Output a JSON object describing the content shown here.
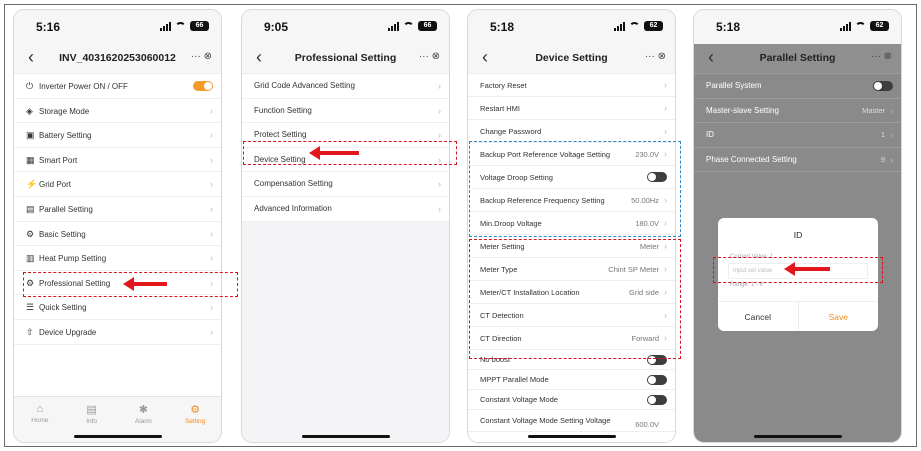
{
  "screens": [
    {
      "time": "5:16",
      "battery": "66",
      "title": "INV_4031620253060012",
      "actions": "··· ⊗",
      "items": [
        {
          "icon": "⏻",
          "label": "Inverter Power ON / OFF",
          "toggle": "on"
        },
        {
          "icon": "◈",
          "label": "Storage Mode"
        },
        {
          "icon": "▣",
          "label": "Battery Setting"
        },
        {
          "icon": "▦",
          "label": "Smart Port"
        },
        {
          "icon": "⚡",
          "label": "Grid Port"
        },
        {
          "icon": "▤",
          "label": "Parallel Setting"
        },
        {
          "icon": "⚙",
          "label": "Basic Setting"
        },
        {
          "icon": "▥",
          "label": "Heat Pump Setting"
        },
        {
          "icon": "⚙",
          "label": "Professional Setting"
        },
        {
          "icon": "☰",
          "label": "Quick Setting"
        },
        {
          "icon": "⇧",
          "label": "Device Upgrade"
        }
      ],
      "tabs": [
        {
          "icon": "⌂",
          "label": "Home"
        },
        {
          "icon": "▤",
          "label": "Info"
        },
        {
          "icon": "✱",
          "label": "Alarm"
        },
        {
          "icon": "⚙",
          "label": "Setting"
        }
      ]
    },
    {
      "time": "9:05",
      "battery": "66",
      "title": "Professional Setting",
      "actions": "··· ⊗",
      "items": [
        {
          "label": "Grid Code Advanced Setting"
        },
        {
          "label": "Function Setting"
        },
        {
          "label": "Protect Setting"
        },
        {
          "label": "Device Setting"
        },
        {
          "label": "Compensation Setting"
        },
        {
          "label": "Advanced Information"
        }
      ]
    },
    {
      "time": "5:18",
      "battery": "62",
      "title": "Device Setting",
      "actions": "··· ⊗",
      "items": [
        {
          "label": "Factory Reset"
        },
        {
          "label": "Restart HMI"
        },
        {
          "label": "Change Password"
        },
        {
          "label": "Backup Port Reference Voltage Setting",
          "value": "230.0V"
        },
        {
          "label": "Voltage Droop Setting",
          "toggle": "off"
        },
        {
          "label": "Backup Reference Frequency Setting",
          "value": "50.00Hz"
        },
        {
          "label": "Min.Droop Voltage",
          "value": "180.0V"
        },
        {
          "label": "Meter Setting",
          "value": "Meter"
        },
        {
          "label": "Meter Type",
          "value": "Chint SP Meter"
        },
        {
          "label": "Meter/CT Installation Location",
          "value": "Grid side"
        },
        {
          "label": "CT Detection"
        },
        {
          "label": "CT Direction",
          "value": "Forward"
        },
        {
          "label": "No boost",
          "toggle": "off"
        },
        {
          "label": "MPPT Parallel Mode",
          "toggle": "off"
        },
        {
          "label": "Constant Voltage Mode",
          "toggle": "off"
        },
        {
          "label": "Constant Voltage Mode Setting Voltage",
          "value": "600.0V"
        }
      ]
    },
    {
      "time": "5:18",
      "battery": "62",
      "title": "Parallel Setting",
      "actions": "··· ⊗",
      "items": [
        {
          "label": "Parallel System",
          "toggle": "off"
        },
        {
          "label": "Master-slave Setting",
          "value": "Master"
        },
        {
          "label": "ID",
          "value": "1"
        },
        {
          "label": "Phase Connected Setting",
          "value": "9"
        }
      ],
      "dialog": {
        "title": "ID",
        "current": "Current Value: 1",
        "placeholder": "Input set value",
        "range": "Range: 1 - 6",
        "cancel": "Cancel",
        "save": "Save"
      }
    }
  ],
  "colors": {
    "accent": "#f08c1e",
    "highlight_red": "#d9151c",
    "highlight_blue": "#2e86c8"
  }
}
